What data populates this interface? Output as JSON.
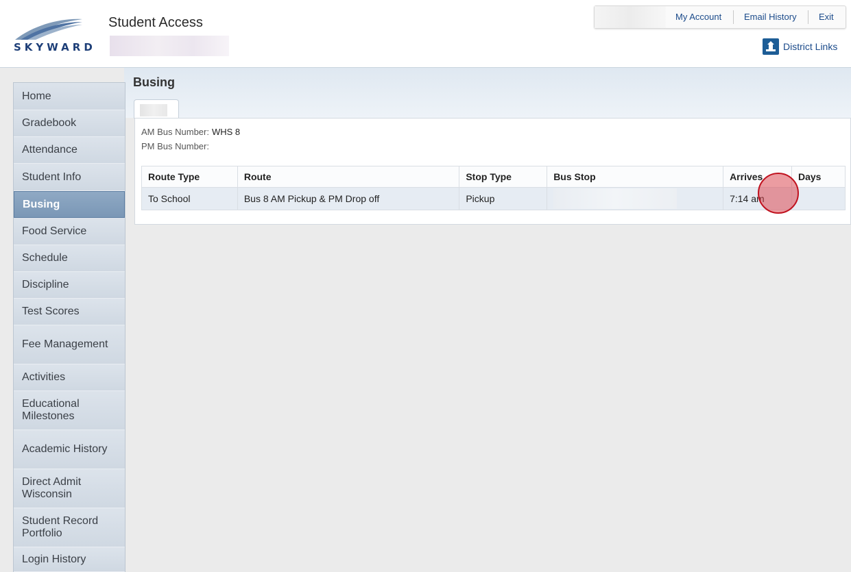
{
  "header": {
    "logo_text": "SKYWARD",
    "app_title": "Student Access",
    "top_links": [
      "My Account",
      "Email History",
      "Exit"
    ],
    "district_links": "District Links"
  },
  "sidebar": {
    "items": [
      {
        "label": "Home"
      },
      {
        "label": "Gradebook"
      },
      {
        "label": "Attendance"
      },
      {
        "label": "Student Info"
      },
      {
        "label": "Busing",
        "active": true
      },
      {
        "label": "Food Service"
      },
      {
        "label": "Schedule"
      },
      {
        "label": "Discipline"
      },
      {
        "label": "Test Scores"
      },
      {
        "label": "Fee Management"
      },
      {
        "label": "Activities"
      },
      {
        "label": "Educational Milestones"
      },
      {
        "label": "Academic History"
      },
      {
        "label": "Direct Admit Wisconsin"
      },
      {
        "label": "Student Record Portfolio"
      },
      {
        "label": "Login History"
      }
    ]
  },
  "main": {
    "title": "Busing",
    "am_bus_label": "AM Bus Number:",
    "am_bus_value": "WHS 8",
    "pm_bus_label": "PM Bus Number:",
    "pm_bus_value": "",
    "table": {
      "headers": [
        "Route Type",
        "Route",
        "Stop Type",
        "Bus Stop",
        "Arrives",
        "Days"
      ],
      "rows": [
        [
          "To School",
          "Bus 8 AM Pickup & PM Drop off",
          "Pickup",
          "",
          "7:14 am",
          ""
        ]
      ]
    }
  },
  "colors": {
    "active_nav": "#7a97b6",
    "link": "#1a4a8a",
    "cursor_marker": "#c0121f"
  }
}
